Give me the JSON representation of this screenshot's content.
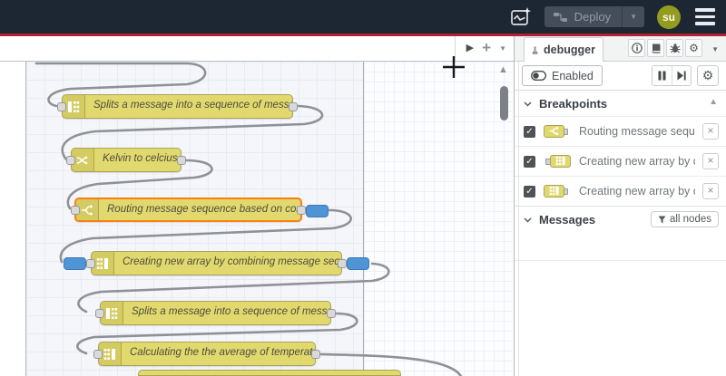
{
  "header": {
    "deploy_label": "Deploy",
    "avatar_text": "su"
  },
  "canvas": {
    "toolbar_icons": [
      "scroll-right-icon",
      "add-flow-icon",
      "dropdown-caret-icon"
    ],
    "nodes": [
      {
        "label": "Splits a message into a sequence of messages.",
        "type": "split",
        "selected": false
      },
      {
        "label": "Kelvin to celcius",
        "type": "change",
        "selected": false
      },
      {
        "label": "Routing message sequence based on condition",
        "type": "switch",
        "selected": true,
        "breakpoint_output": true
      },
      {
        "label": "Creating new array by combining message sequence",
        "type": "join",
        "selected": false,
        "breakpoint_input": true,
        "breakpoint_output": true
      },
      {
        "label": "Splits a message into a sequence of messages.",
        "type": "split",
        "selected": false
      },
      {
        "label": "Calculating the the average of temperature",
        "type": "join",
        "selected": false
      },
      {
        "label": "",
        "type": "partial",
        "selected": false
      }
    ]
  },
  "sidebar": {
    "tab_label": "debugger",
    "toolbar": {
      "enabled_label": "Enabled"
    },
    "breakpoints": {
      "title": "Breakpoints",
      "items": [
        {
          "label": "Routing message sequence ba",
          "icon": "switch-node-icon",
          "port_side": "output"
        },
        {
          "label": "Creating new array by combini",
          "icon": "join-node-icon",
          "port_side": "input"
        },
        {
          "label": "Creating new array by combini",
          "icon": "join-node-icon",
          "port_side": "output"
        }
      ]
    },
    "messages": {
      "title": "Messages",
      "filter_label": "all nodes"
    }
  },
  "colors": {
    "header_bg": "#1d2734",
    "deploy_bar_red": "#b1222f",
    "node_yellow": "#e2d96e",
    "node_border": "#a9a35a",
    "selected_border": "#ff7f0e",
    "breakpoint_blue": "#4f94d7",
    "wire_gray": "#8e9196",
    "avatar_olive": "#939c1f"
  }
}
